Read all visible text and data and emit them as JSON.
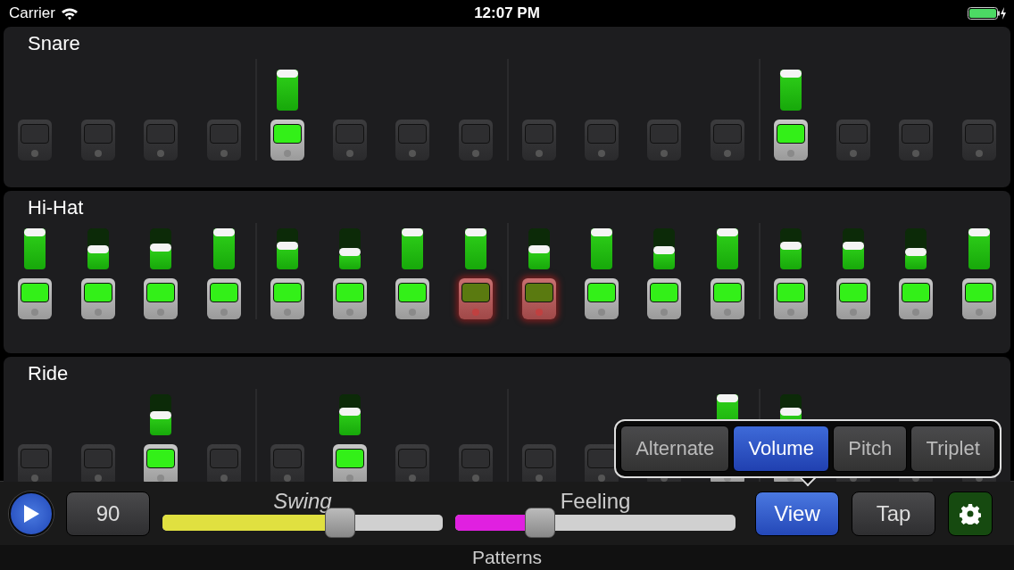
{
  "status_bar": {
    "carrier": "Carrier",
    "time": "12:07 PM"
  },
  "tracks": [
    {
      "name": "Snare",
      "steps": [
        {
          "on": false
        },
        {
          "on": false
        },
        {
          "on": false
        },
        {
          "on": false
        },
        {
          "on": true,
          "level": 1
        },
        {
          "on": false
        },
        {
          "on": false
        },
        {
          "on": false
        },
        {
          "on": false
        },
        {
          "on": false
        },
        {
          "on": false
        },
        {
          "on": false
        },
        {
          "on": true,
          "level": 1
        },
        {
          "on": false
        },
        {
          "on": false
        },
        {
          "on": false
        }
      ]
    },
    {
      "name": "Hi-Hat",
      "steps": [
        {
          "on": true,
          "level": 1
        },
        {
          "on": true,
          "level": 0.5
        },
        {
          "on": true,
          "level": 0.55
        },
        {
          "on": true,
          "level": 1
        },
        {
          "on": true,
          "level": 0.6
        },
        {
          "on": true,
          "level": 0.4
        },
        {
          "on": true,
          "level": 1
        },
        {
          "on": true,
          "level": 1,
          "playing": true
        },
        {
          "on": true,
          "level": 0.5,
          "playing": true
        },
        {
          "on": true,
          "level": 1
        },
        {
          "on": true,
          "level": 0.45
        },
        {
          "on": true,
          "level": 1
        },
        {
          "on": true,
          "level": 0.6
        },
        {
          "on": true,
          "level": 0.6
        },
        {
          "on": true,
          "level": 0.4
        },
        {
          "on": true,
          "level": 1
        }
      ]
    },
    {
      "name": "Ride",
      "steps": [
        {
          "on": false
        },
        {
          "on": false
        },
        {
          "on": true,
          "level": 0.5
        },
        {
          "on": false
        },
        {
          "on": false
        },
        {
          "on": true,
          "level": 0.6
        },
        {
          "on": false
        },
        {
          "on": false
        },
        {
          "on": false
        },
        {
          "on": false
        },
        {
          "on": false
        },
        {
          "on": true,
          "level": 1
        },
        {
          "on": true,
          "level": 0.6
        },
        {
          "on": false
        },
        {
          "on": false
        },
        {
          "on": false
        }
      ]
    }
  ],
  "view_menu": [
    {
      "label": "Alternate",
      "selected": false
    },
    {
      "label": "Volume",
      "selected": true
    },
    {
      "label": "Pitch",
      "selected": false
    },
    {
      "label": "Triplet",
      "selected": false
    }
  ],
  "toolbar": {
    "tempo": "90",
    "sliders": [
      {
        "label": "Swing",
        "level": 0.65,
        "color": "#e0e040"
      },
      {
        "label": "Feeling",
        "level": 0.28,
        "color": "#e020e0"
      }
    ],
    "view_button": {
      "label": "View",
      "selected": true
    },
    "tap_button": "Tap"
  },
  "footer": "Patterns"
}
